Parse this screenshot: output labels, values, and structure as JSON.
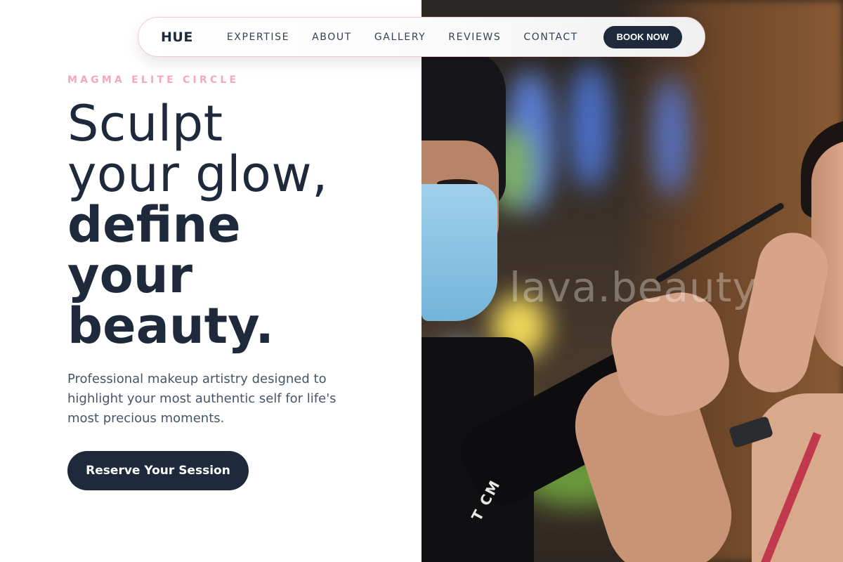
{
  "nav": {
    "logo": "HUE",
    "links": [
      "EXPERTISE",
      "ABOUT",
      "GALLERY",
      "REVIEWS",
      "CONTACT"
    ],
    "cta": "BOOK NOW"
  },
  "hero": {
    "eyebrow": "MAGMA ELITE CIRCLE",
    "headline_light_1": "Sculpt",
    "headline_light_2": "your glow,",
    "headline_bold_1": "define",
    "headline_bold_2": "your",
    "headline_bold_3": "beauty.",
    "subtitle": "Professional makeup artistry designed to highlight your most authentic self for life's most precious moments.",
    "cta": "Reserve Your Session"
  },
  "photo": {
    "watermark": "lava.beauty",
    "shirt_text": "T CM"
  },
  "colors": {
    "navy": "#1e293b",
    "pink_accent": "#f2a9b9",
    "nav_border": "#f2c9d2"
  }
}
